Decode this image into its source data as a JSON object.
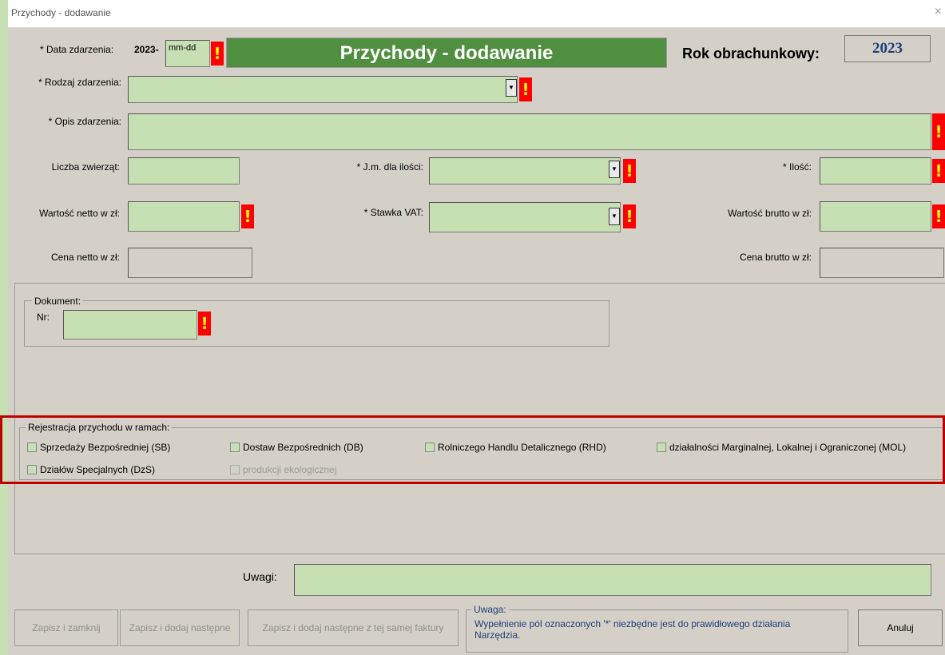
{
  "window": {
    "title": "Przychody - dodawanie",
    "close_label": "×"
  },
  "header": {
    "date_label": "* Data zdarzenia:",
    "date_year": "2023-",
    "date_placeholder": "mm-dd",
    "banner": "Przychody - dodawanie",
    "fiscal_label": "Rok obrachunkowy:",
    "fiscal_year": "2023"
  },
  "form": {
    "rodzaj_label": "* Rodzaj zdarzenia:",
    "opis_label": "* Opis zdarzenia:",
    "liczba_label": "Liczba zwierząt:",
    "jm_label": "* J.m. dla ilości:",
    "ilosc_label": "* Ilość:",
    "netto_label": "Wartość netto w zł:",
    "vat_label": "* Stawka VAT:",
    "brutto_label": "Wartość brutto w zł:",
    "cena_netto_label": "Cena netto w zł:",
    "cena_brutto_label": "Cena brutto w zł:"
  },
  "required_marker": "!",
  "dropdown_arrow": "▼",
  "dokument": {
    "legend": "Dokument:",
    "nr_label": "Nr:"
  },
  "rejestracja": {
    "legend": "Rejestracja przychodu w ramach:",
    "options": [
      {
        "label": "Sprzedaży Bezpośredniej (SB)"
      },
      {
        "label": "Dostaw Bezpośrednich (DB)"
      },
      {
        "label": "Rolniczego Handlu Detalicznego (RHD)"
      },
      {
        "label": "działalności Marginalnej, Lokalnej i Ograniczonej (MOL)"
      },
      {
        "label": "Działów Specjalnych (DzS)"
      },
      {
        "label": "produkcji ekologicznej"
      }
    ]
  },
  "uwagi_label": "Uwagi:",
  "note": {
    "legend": "Uwaga:",
    "text": "Wypełnienie pól oznaczonych '*' niezbędne jest do prawidłowego działania Narzędzia."
  },
  "buttons": {
    "save_close": "Zapisz i zamknij",
    "save_next": "Zapisz i dodaj następne",
    "save_next_same": "Zapisz i dodaj następne z tej samej faktury",
    "cancel": "Anuluj"
  },
  "colors": {
    "field": "#c6e0b4",
    "banner": "#4f8f3f",
    "required": "#ff0000",
    "highlight_border": "#c00000"
  }
}
